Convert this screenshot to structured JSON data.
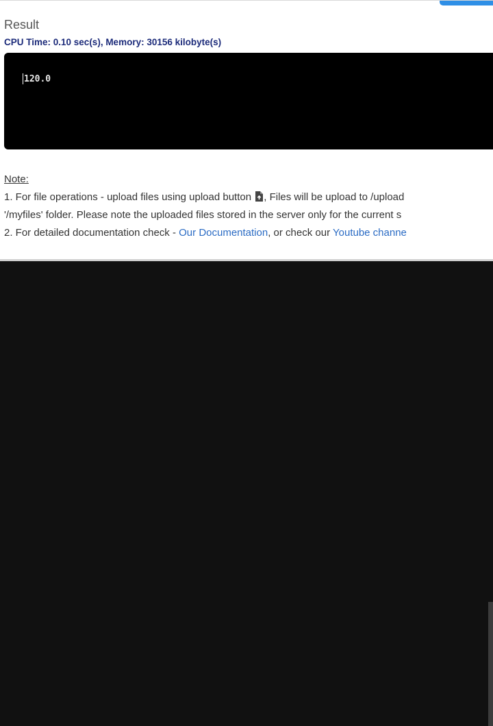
{
  "result": {
    "title": "Result",
    "stats": "CPU Time: 0.10 sec(s), Memory: 30156 kilobyte(s)",
    "output": "120.0"
  },
  "note": {
    "heading": "Note:",
    "line1_before": "1. For file operations - upload files using upload button ",
    "line1_after": ", Files will be upload to /upload",
    "line2": "'/myfiles' folder. Please note the uploaded files stored in the server only for the current s",
    "line3_before": "2. For detailed documentation check - ",
    "documentation_link": "Our Documentation",
    "line3_middle": ", or check our ",
    "youtube_link": "Youtube channe"
  },
  "icons": {
    "upload": "upload-file-icon"
  },
  "colors": {
    "stats_text": "#1c2b7a",
    "link": "#2a6bc4",
    "output_bg": "#000000",
    "page_bg": "#111111",
    "accent_button": "#2f8fe6"
  }
}
